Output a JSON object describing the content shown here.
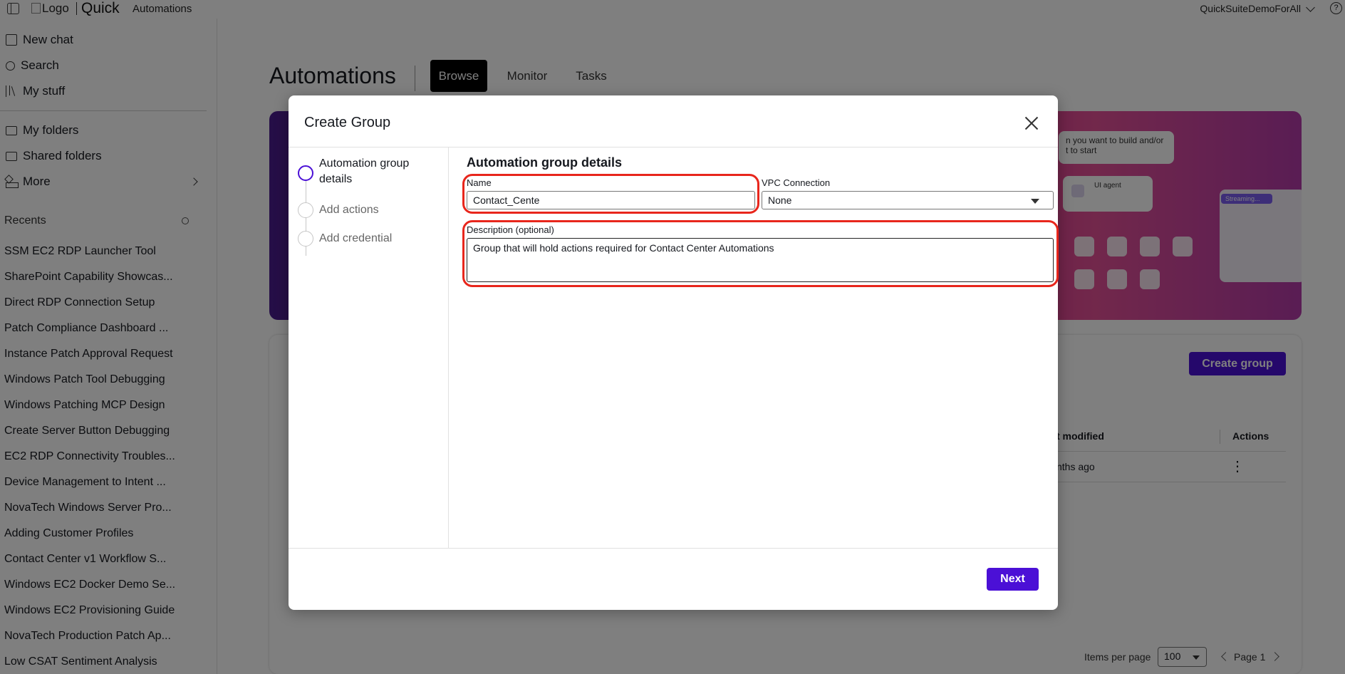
{
  "topbar": {
    "logo_alt": "Logo",
    "brand": "Quick",
    "breadcrumb": "Automations",
    "account": "QuickSuiteDemoForAll",
    "help_glyph": "?"
  },
  "sidebar": {
    "nav": [
      {
        "label": "New chat",
        "icon": "pencil-square-icon"
      },
      {
        "label": "Search",
        "icon": "search-icon"
      },
      {
        "label": "My stuff",
        "icon": "books-icon"
      }
    ],
    "folders": [
      {
        "label": "My folders",
        "icon": "folder-icon"
      },
      {
        "label": "Shared folders",
        "icon": "shared-folder-icon"
      },
      {
        "label": "More",
        "icon": "shapes-icon"
      }
    ],
    "recents_title": "Recents",
    "recents": [
      "SSM EC2 RDP Launcher Tool",
      "SharePoint Capability Showcas...",
      "Direct RDP Connection Setup",
      "Patch Compliance Dashboard ...",
      "Instance Patch Approval Request",
      "Windows Patch Tool Debugging",
      "Windows Patching MCP Design",
      "Create Server Button Debugging",
      "EC2 RDP Connectivity Troubles...",
      "Device Management to Intent ...",
      "NovaTech Windows Server Pro...",
      "Adding Customer Profiles",
      "Contact Center v1 Workflow S...",
      "Windows EC2 Docker Demo Se...",
      "Windows EC2 Provisioning Guide",
      "NovaTech Production Patch Ap...",
      "Low CSAT Sentiment Analysis"
    ]
  },
  "main": {
    "title": "Automations",
    "tabs": [
      "Browse",
      "Monitor",
      "Tasks"
    ],
    "active_tab": "Browse",
    "hero": {
      "card_text": "n you want to build and/or\nt to start",
      "agent_label": "UI agent",
      "streaming_label": "Streaming..."
    },
    "create_group_label": "Create group",
    "table": {
      "headers": [
        "t modified",
        "Actions"
      ],
      "rows": [
        {
          "modified": "nths ago",
          "actions_glyph": "⋮"
        }
      ]
    },
    "pager": {
      "items_label": "Items per page",
      "items_value": "100",
      "page_label": "Page 1"
    }
  },
  "modal": {
    "title": "Create Group",
    "steps": [
      "Automation group details",
      "Add actions",
      "Add credential"
    ],
    "active_step": 0,
    "section_title": "Automation group details",
    "name_label": "Name",
    "name_value": "Contact_Cente",
    "vpc_label": "VPC Connection",
    "vpc_value": "None",
    "description_label": "Description (optional)",
    "description_value": "Group that will hold actions required for Contact Center Automations",
    "next_label": "Next"
  },
  "colors": {
    "primary": "#4b10d6",
    "highlight": "#e8261c",
    "overlay": "rgba(0,0,0,0.5)"
  }
}
